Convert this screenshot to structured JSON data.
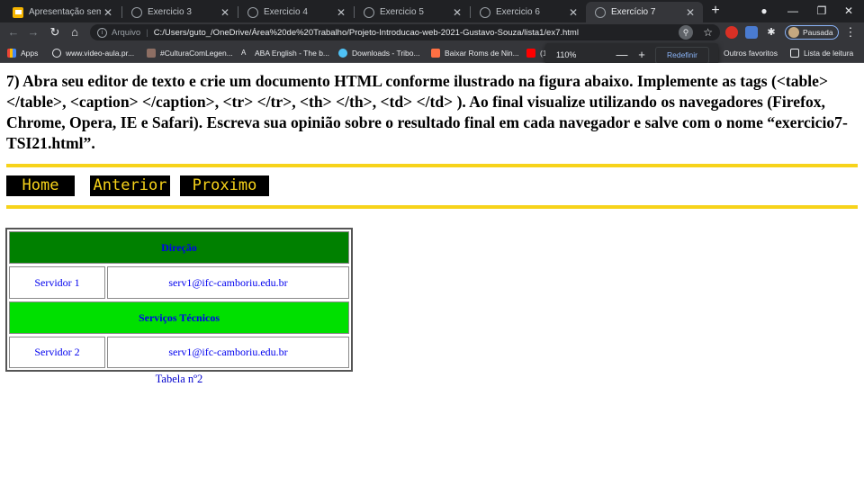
{
  "browser": {
    "tabs": [
      {
        "title": "Apresentação sem títu"
      },
      {
        "title": "Exercicio 3"
      },
      {
        "title": "Exercicio 4"
      },
      {
        "title": "Exercicio 5"
      },
      {
        "title": "Exercicio 6"
      },
      {
        "title": "Exercício 7",
        "active": true
      }
    ],
    "address": {
      "security_label": "Arquivo",
      "url": "C:/Users/guto_/OneDrive/Área%20de%20Trabalho/Projeto-Introducao-web-2021-Gustavo-Souza/lista1/ex7.html"
    },
    "profile_label": "Pausada",
    "bookmarks": [
      {
        "label": "Apps"
      },
      {
        "label": "www.video-aula.pr..."
      },
      {
        "label": "#CulturaComLegen..."
      },
      {
        "label": "ABA English - The b..."
      },
      {
        "label": "Downloads - Tribo..."
      },
      {
        "label": "Baixar Roms de Nin..."
      },
      {
        "label": "(1"
      }
    ],
    "bookmarks_right": {
      "other": "Outros favoritos",
      "reading": "Lista de leitura"
    },
    "zoom_popup": {
      "value": "110%",
      "minus": "—",
      "plus": "+",
      "reset": "Redefinir"
    }
  },
  "page": {
    "question": "7) Abra seu editor de texto e crie um documento HTML conforme ilustrado na figura abaixo. Implemente as tags (<table> </table>, <caption> </caption>, <tr> </tr>, <th> </th>, <td> </td> ). Ao final visualize utilizando os navegadores (Firefox, Chrome, Opera, IE e Safari). Escreva sua opinião sobre o resultado final em cada navegador e salve com o nome “exercicio7-TSI21.html”.",
    "nav": {
      "home": "Home",
      "anterior": "Anterior",
      "proximo": "Proximo"
    },
    "colors": {
      "rule": "#f7d31a",
      "header_dark": "#008000",
      "header_light": "#00e000",
      "link": "#0000ee"
    },
    "table": {
      "rows": [
        {
          "type": "header",
          "label": "Direção",
          "bg": "#008000"
        },
        {
          "type": "data",
          "name": "Servidor 1",
          "email": "serv1@ifc-camboriu.edu.br"
        },
        {
          "type": "header",
          "label": "Serviços Técnicos",
          "bg": "#00e000"
        },
        {
          "type": "data",
          "name": "Servidor 2",
          "email": "serv1@ifc-camboriu.edu.br"
        }
      ],
      "caption": "Tabela nº2"
    }
  }
}
